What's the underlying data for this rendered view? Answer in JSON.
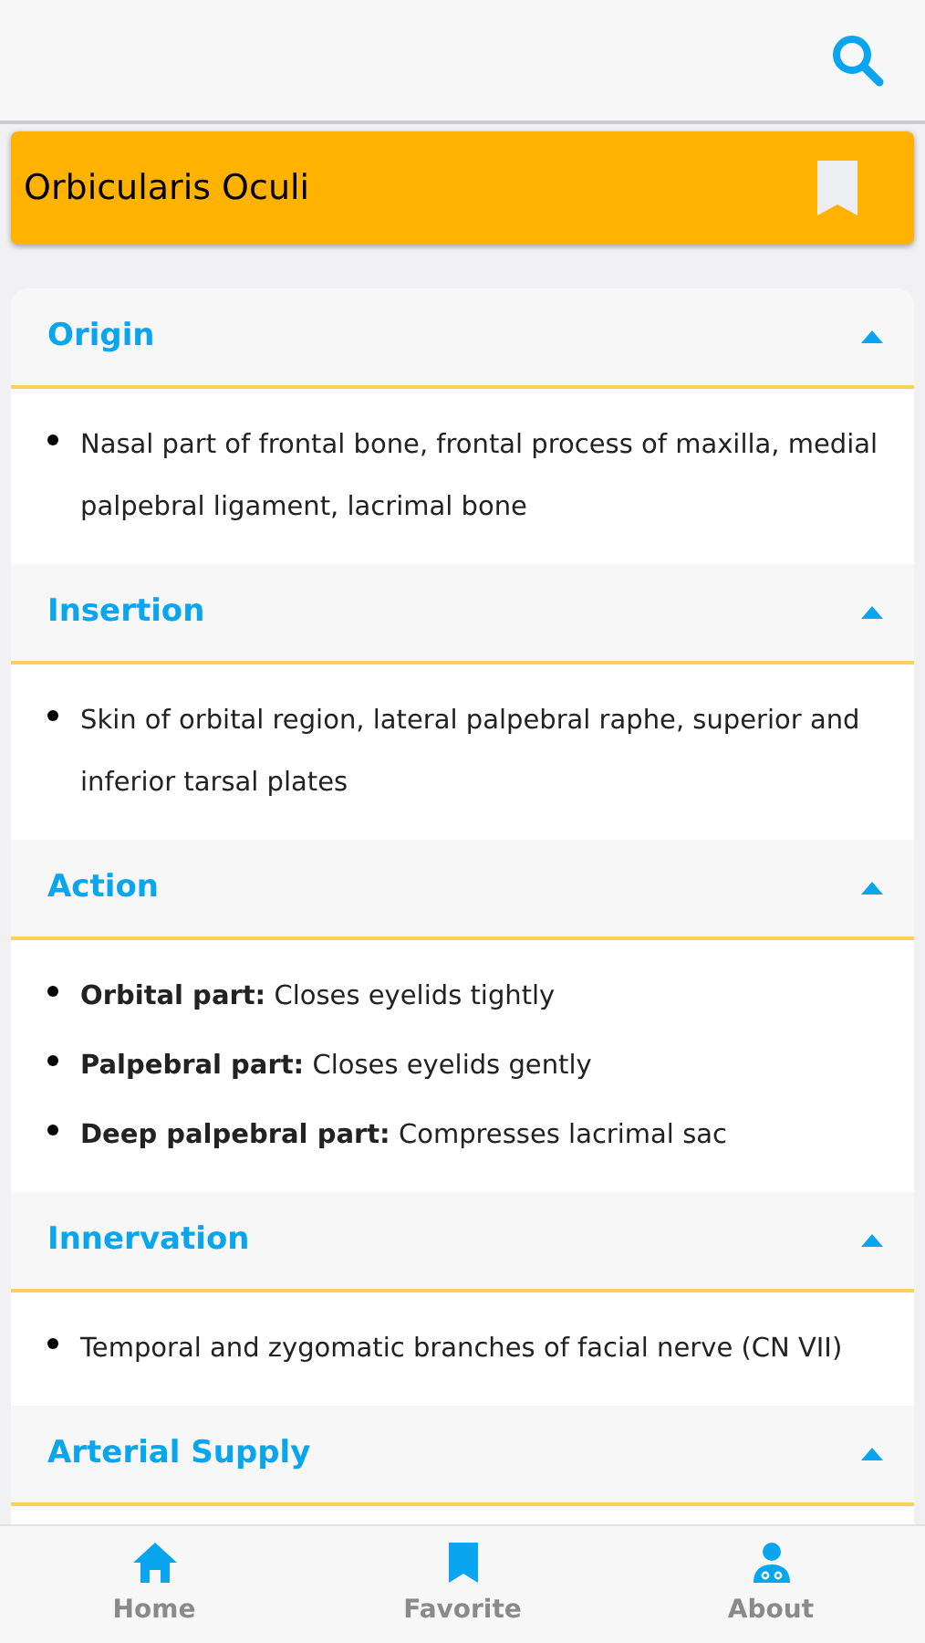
{
  "title": "Orbicularis Oculi",
  "sections": [
    {
      "heading": "Origin",
      "expanded": true,
      "items": [
        "Nasal part of frontal bone, frontal process of maxilla, medial palpebral ligament, lacrimal bone"
      ]
    },
    {
      "heading": "Insertion",
      "expanded": true,
      "items": [
        "Skin of orbital region, lateral palpebral raphe, superior and inferior tarsal plates"
      ]
    },
    {
      "heading": "Action",
      "expanded": true,
      "items": [
        "**Orbital part:** Closes eyelids tightly",
        "**Palpebral part:** Closes eyelids gently",
        "**Deep palpebral part:** Compresses lacrimal sac"
      ]
    },
    {
      "heading": "Innervation",
      "expanded": true,
      "items": [
        "Temporal and zygomatic branches of facial nerve (CN VII)"
      ]
    },
    {
      "heading": "Arterial Supply",
      "expanded": true
    }
  ],
  "nav": [
    {
      "label": "Home",
      "kind": "home"
    },
    {
      "label": "Favorite",
      "kind": "favorite"
    },
    {
      "label": "About",
      "kind": "about"
    }
  ]
}
